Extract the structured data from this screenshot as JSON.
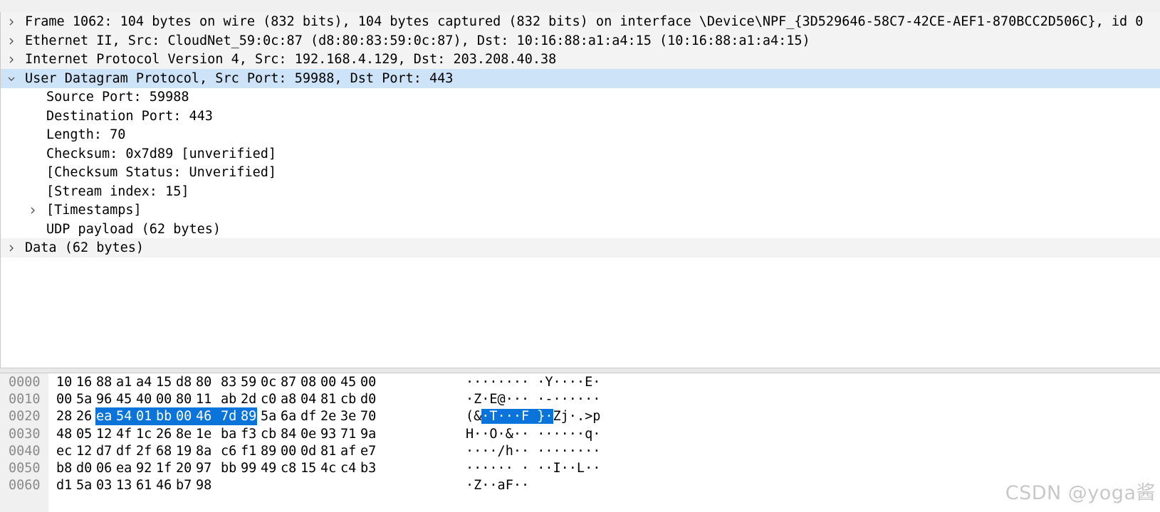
{
  "tree": [
    {
      "level": 0,
      "expanded": false,
      "text": "Frame 1062: 104 bytes on wire (832 bits), 104 bytes captured (832 bits) on interface \\Device\\NPF_{3D529646-58C7-42CE-AEF1-870BCC2D506C}, id 0"
    },
    {
      "level": 0,
      "expanded": false,
      "text": "Ethernet II, Src: CloudNet_59:0c:87 (d8:80:83:59:0c:87), Dst: 10:16:88:a1:a4:15 (10:16:88:a1:a4:15)"
    },
    {
      "level": 0,
      "expanded": false,
      "text": "Internet Protocol Version 4, Src: 192.168.4.129, Dst: 203.208.40.38"
    },
    {
      "level": 0,
      "expanded": true,
      "selected": true,
      "text": "User Datagram Protocol, Src Port: 59988, Dst Port: 443"
    },
    {
      "level": 1,
      "text": "Source Port: 59988"
    },
    {
      "level": 1,
      "text": "Destination Port: 443"
    },
    {
      "level": 1,
      "text": "Length: 70"
    },
    {
      "level": 1,
      "text": "Checksum: 0x7d89 [unverified]"
    },
    {
      "level": 1,
      "text": "[Checksum Status: Unverified]"
    },
    {
      "level": 1,
      "text": "[Stream index: 15]"
    },
    {
      "level": 1,
      "expandable": true,
      "expanded": false,
      "text": "[Timestamps]"
    },
    {
      "level": 1,
      "text": "UDP payload (62 bytes)"
    },
    {
      "level": 0,
      "expanded": false,
      "text": "Data (62 bytes)"
    }
  ],
  "hex_dump": [
    {
      "offset": "0000",
      "bytes": [
        "10",
        "16",
        "88",
        "a1",
        "a4",
        "15",
        "d8",
        "80",
        "83",
        "59",
        "0c",
        "87",
        "08",
        "00",
        "45",
        "00"
      ],
      "ascii": "········ ·Y····E·"
    },
    {
      "offset": "0010",
      "bytes": [
        "00",
        "5a",
        "96",
        "45",
        "40",
        "00",
        "80",
        "11",
        "ab",
        "2d",
        "c0",
        "a8",
        "04",
        "81",
        "cb",
        "d0"
      ],
      "ascii": "·Z·E@··· ·-······"
    },
    {
      "offset": "0020",
      "bytes": [
        "28",
        "26",
        "ea",
        "54",
        "01",
        "bb",
        "00",
        "46",
        "7d",
        "89",
        "5a",
        "6a",
        "df",
        "2e",
        "3e",
        "70"
      ],
      "ascii": "(&·T···F }·Zj·.>p"
    },
    {
      "offset": "0030",
      "bytes": [
        "48",
        "05",
        "12",
        "4f",
        "1c",
        "26",
        "8e",
        "1e",
        "ba",
        "f3",
        "cb",
        "84",
        "0e",
        "93",
        "71",
        "9a"
      ],
      "ascii": "H··O·&·· ······q·"
    },
    {
      "offset": "0040",
      "bytes": [
        "ec",
        "12",
        "d7",
        "df",
        "2f",
        "68",
        "19",
        "8a",
        "c6",
        "f1",
        "89",
        "00",
        "0d",
        "81",
        "af",
        "e7"
      ],
      "ascii": "····/h·· ········"
    },
    {
      "offset": "0050",
      "bytes": [
        "b8",
        "d0",
        "06",
        "ea",
        "92",
        "1f",
        "20",
        "97",
        "bb",
        "99",
        "49",
        "c8",
        "15",
        "4c",
        "c4",
        "b3"
      ],
      "ascii": "······ · ··I··L··"
    },
    {
      "offset": "0060",
      "bytes": [
        "d1",
        "5a",
        "03",
        "13",
        "61",
        "46",
        "b7",
        "98"
      ],
      "ascii": "·Z··aF··"
    }
  ],
  "highlight": {
    "row": 2,
    "start": 2,
    "end": 9
  },
  "colors": {
    "selection": "#cde3f7",
    "highlight": "#0a74da"
  },
  "watermark": "CSDN @yoga酱"
}
